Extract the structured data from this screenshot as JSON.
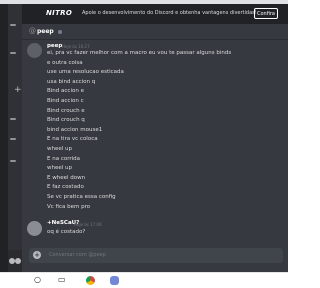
{
  "nitro_banner": {
    "logo": "NITRO",
    "text": "Apoie o desenvolvimento do Discord e obtenha vantagens divertidas!",
    "button": "Confira",
    "close": "×"
  },
  "header": {
    "at": "@",
    "name": "peep"
  },
  "messages": [
    {
      "author": "peep",
      "time": "Hoje às 16:27",
      "lines": [
        "ei, pra vc fazer melhor com a macro eu vou te passar alguns binds",
        "e outra coisa",
        "use uma resolucao esticada",
        "usa bind accion q",
        "Bind accion e",
        "Bind accion c",
        "Bind crouch e",
        "Bind crouch q",
        "bind accion mouse1",
        "E na tira vc coloca",
        "wheel up",
        "E na corrida",
        "wheel up",
        "E wheel down",
        "E faz costado",
        "Se vc pratica essa config",
        "Vc fica bem pro"
      ]
    },
    {
      "author": "+NeSCaU?",
      "time": "Hoje às 17:06",
      "lines": [
        "oq é costado?"
      ]
    }
  ],
  "input": {
    "add": "+",
    "placeholder": "Conversar com @peep"
  },
  "sidebar": {
    "plus": "+"
  },
  "taskbar": {
    "search": "○",
    "taskview": "▭"
  },
  "colors": {
    "app_bg": "#36393f",
    "nitro_bg": "#202225",
    "taskbar_bg": "#ffffff"
  }
}
